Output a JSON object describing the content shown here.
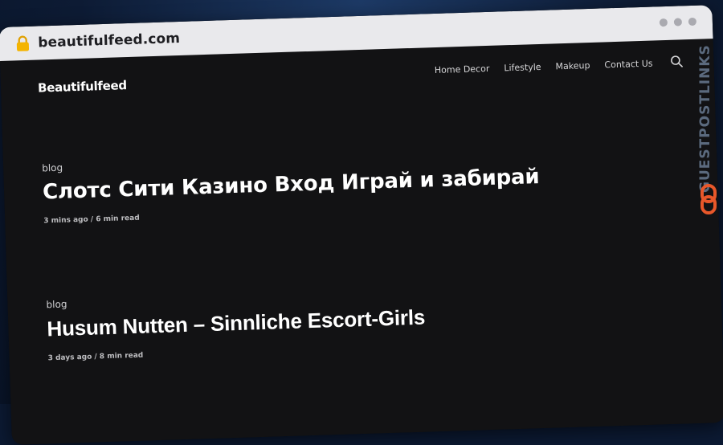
{
  "browser": {
    "url": "beautifulfeed.com",
    "lock_icon": "lock-icon",
    "lock_color": "#f4b400"
  },
  "site": {
    "logo": "Beautifulfeed",
    "nav": [
      "Home Decor",
      "Lifestyle",
      "Makeup",
      "Contact Us"
    ],
    "search_icon": "search-icon"
  },
  "posts": [
    {
      "category": "blog",
      "title": "Слотс Сити Казино Вход Играй и забирай",
      "meta": "3 mins ago / 6 min read"
    },
    {
      "category": "blog",
      "title": "Husum Nutten – Sinnliche Escort-Girls",
      "meta": "3 days ago / 8 min read"
    }
  ],
  "watermark": {
    "text": "GUESTPOSTLINKS",
    "icon": "chain-link-icon",
    "accent": "#e8572a"
  }
}
